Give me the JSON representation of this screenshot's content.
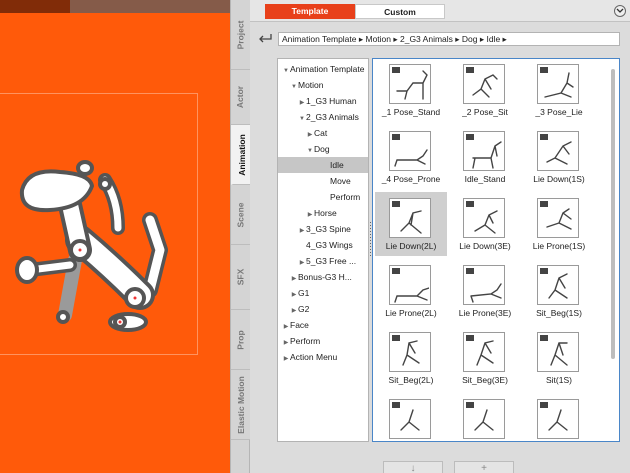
{
  "vtabs": [
    "Project",
    "Actor",
    "Animation",
    "Scene",
    "SFX",
    "Prop",
    "Elastic Motion"
  ],
  "active_vtab": "Animation",
  "top_tabs": {
    "template": "Template",
    "custom": "Custom"
  },
  "breadcrumb": "Animation Template ▸ Motion ▸ 2_G3 Animals ▸ Dog ▸ Idle ▸",
  "tree": [
    {
      "label": "Animation Template",
      "arrow": "▼"
    },
    {
      "label": "Motion",
      "arrow": "▼"
    },
    {
      "label": "1_G3 Human",
      "arrow": "▶"
    },
    {
      "label": "2_G3 Animals",
      "arrow": "▼"
    },
    {
      "label": "Cat",
      "arrow": "▶"
    },
    {
      "label": "Dog",
      "arrow": "▼"
    },
    {
      "label": "Idle",
      "arrow": ""
    },
    {
      "label": "Move",
      "arrow": ""
    },
    {
      "label": "Perform",
      "arrow": ""
    },
    {
      "label": "Horse",
      "arrow": "▶"
    },
    {
      "label": "3_G3 Spine",
      "arrow": "▶"
    },
    {
      "label": "4_G3 Wings",
      "arrow": ""
    },
    {
      "label": "5_G3 Free ...",
      "arrow": "▶"
    },
    {
      "label": "Bonus-G3 H...",
      "arrow": "▶"
    },
    {
      "label": "G1",
      "arrow": "▶"
    },
    {
      "label": "G2",
      "arrow": "▶"
    },
    {
      "label": "Face",
      "arrow": "▶"
    },
    {
      "label": "Perform",
      "arrow": "▶"
    },
    {
      "label": "Action Menu",
      "arrow": "▶"
    }
  ],
  "selected_tree_item": "Idle",
  "grid_items": [
    "_1 Pose_Stand",
    "_2 Pose_Sit",
    "_3 Pose_Lie",
    "_4 Pose_Prone",
    "Idle_Stand",
    "Lie Down(1S)",
    "Lie Down(2L)",
    "Lie Down(3E)",
    "Lie Prone(1S)",
    "Lie Prone(2L)",
    "Lie Prone(3E)",
    "Sit_Beg(1S)",
    "Sit_Beg(2L)",
    "Sit_Beg(3E)",
    "Sit(1S)",
    "",
    "",
    ""
  ],
  "selected_grid_item": "Lie Down(2L)",
  "bottom_buttons": [
    "↓",
    "+"
  ],
  "colors": {
    "stage": "#ff5a0a",
    "accent": "#e8401a",
    "selection_border": "#4a86c8"
  }
}
